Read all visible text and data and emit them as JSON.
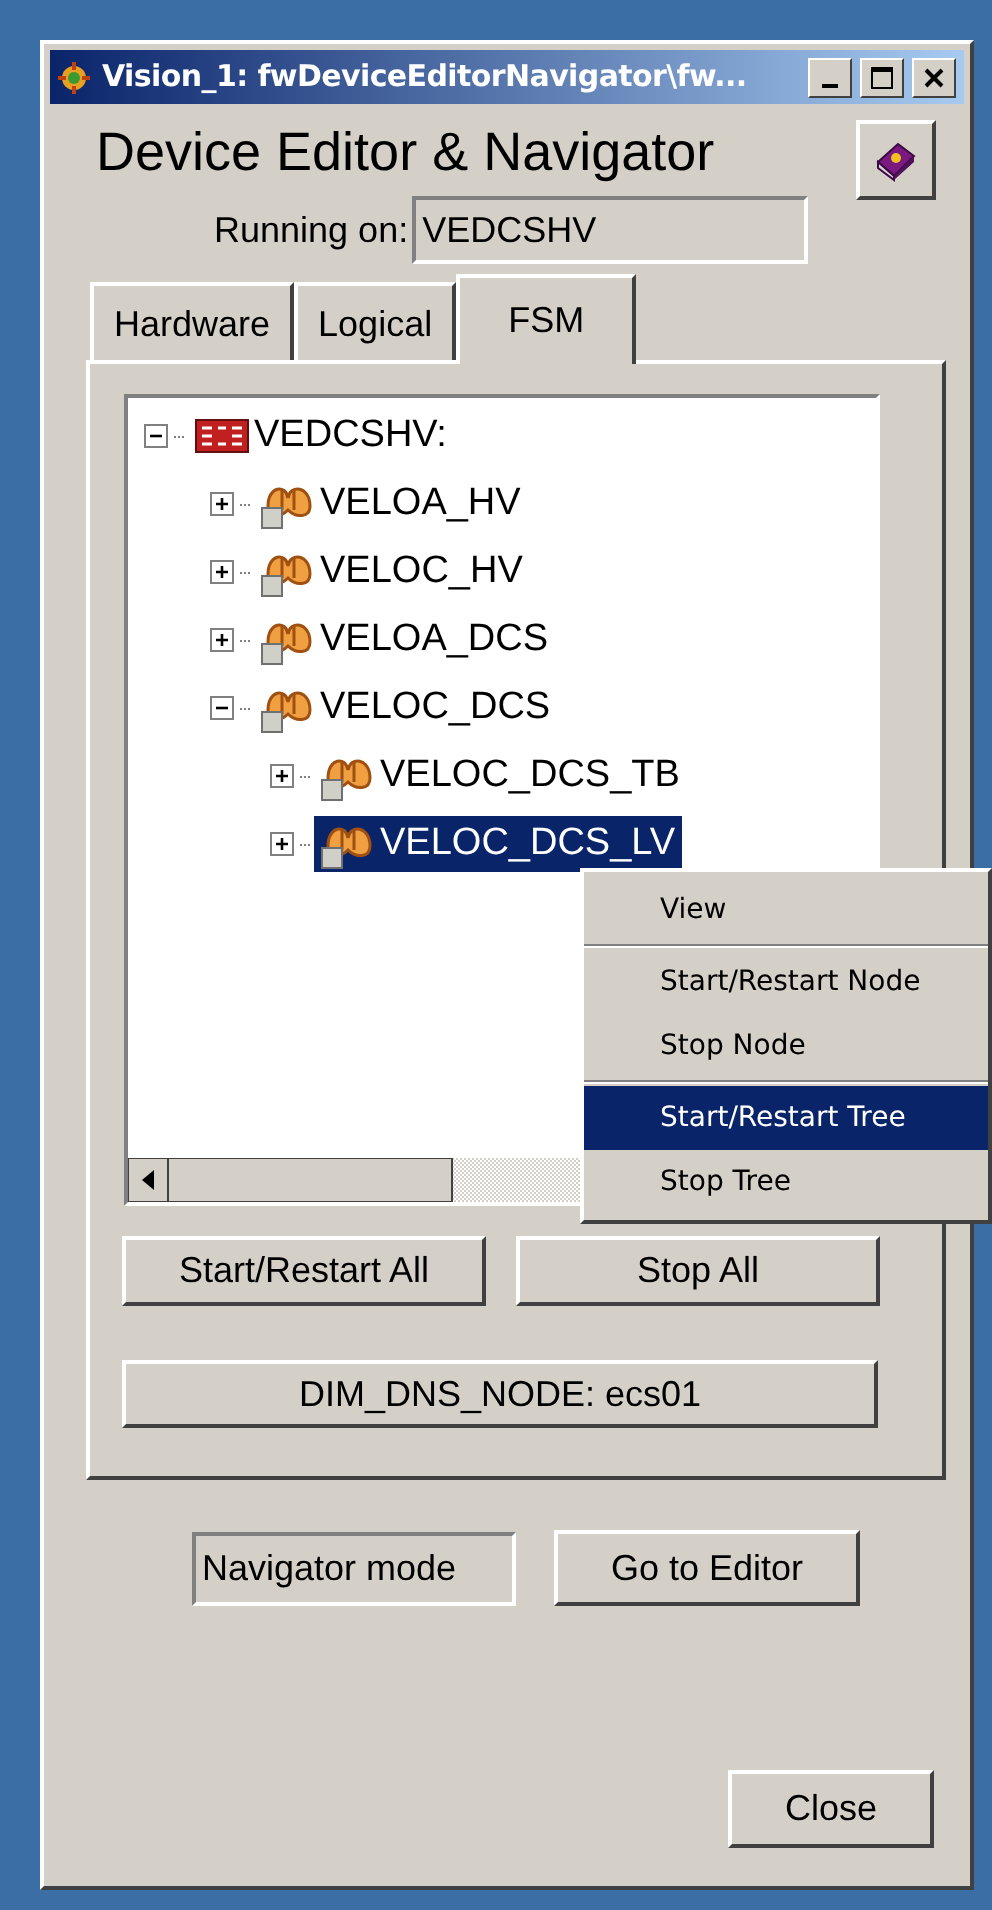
{
  "window": {
    "title": "Vision_1: fwDeviceEditorNavigator\\fw..."
  },
  "header": {
    "title": "Device Editor & Navigator",
    "running_on_label": "Running on:",
    "running_on_value": "VEDCSHV"
  },
  "tabs": [
    {
      "label": "Hardware",
      "selected": false
    },
    {
      "label": "Logical",
      "selected": false
    },
    {
      "label": "FSM",
      "selected": true
    }
  ],
  "tree": {
    "label": "VEDCSHV:",
    "kind": "system",
    "expanded": true,
    "selected": false,
    "children": [
      {
        "label": "VELOA_HV",
        "kind": "node",
        "expanded": false,
        "selected": false
      },
      {
        "label": "VELOC_HV",
        "kind": "node",
        "expanded": false,
        "selected": false
      },
      {
        "label": "VELOA_DCS",
        "kind": "node",
        "expanded": false,
        "selected": false
      },
      {
        "label": "VELOC_DCS",
        "kind": "node",
        "expanded": true,
        "selected": false,
        "children": [
          {
            "label": "VELOC_DCS_TB",
            "kind": "node",
            "expanded": false,
            "selected": false
          },
          {
            "label": "VELOC_DCS_LV",
            "kind": "node",
            "expanded": false,
            "selected": true
          }
        ]
      }
    ]
  },
  "context_menu": [
    {
      "label": "View",
      "selected": false,
      "separator_after": true
    },
    {
      "label": "Start/Restart Node",
      "selected": false,
      "separator_after": false
    },
    {
      "label": "Stop Node",
      "selected": false,
      "separator_after": true
    },
    {
      "label": "Start/Restart Tree",
      "selected": true,
      "separator_after": false
    },
    {
      "label": "Stop Tree",
      "selected": false,
      "separator_after": false
    }
  ],
  "panel_buttons": [
    "Start/Restart All",
    "Stop All"
  ],
  "dns_button": "DIM_DNS_NODE: ecs01",
  "mode_field": "Navigator mode",
  "editor_button": "Go to Editor",
  "close_button": "Close"
}
